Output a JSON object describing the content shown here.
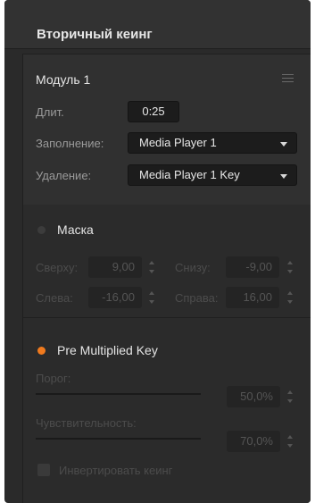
{
  "header": {
    "title": "Вторичный кеинг"
  },
  "module": {
    "title": "Модуль 1",
    "duration_label": "Длит.",
    "duration_value": "0:25",
    "fill_label": "Заполнение:",
    "fill_value": "Media Player 1",
    "key_label": "Удаление:",
    "key_value": "Media Player 1 Key"
  },
  "mask": {
    "title": "Маска",
    "enabled": false,
    "top_label": "Сверху:",
    "top_value": "9,00",
    "bottom_label": "Снизу:",
    "bottom_value": "-9,00",
    "left_label": "Слева:",
    "left_value": "-16,00",
    "right_label": "Справа:",
    "right_value": "16,00"
  },
  "premult": {
    "title": "Pre Multiplied Key",
    "enabled": true,
    "clip_label": "Порог:",
    "clip_value": "50,0%",
    "clip_level": 0.5,
    "gain_label": "Чувствительность:",
    "gain_value": "70,0%",
    "gain_level": 0.7,
    "invert_label": "Инвертировать кеинг",
    "invert_checked": false
  },
  "colors": {
    "accent": "#f07a1e",
    "mask_dot": "#3c3c3c"
  },
  "icons": {
    "menu": "hamburger-menu-icon",
    "dropdown": "caret-down-icon",
    "stepper": "up-down-stepper-icon"
  }
}
